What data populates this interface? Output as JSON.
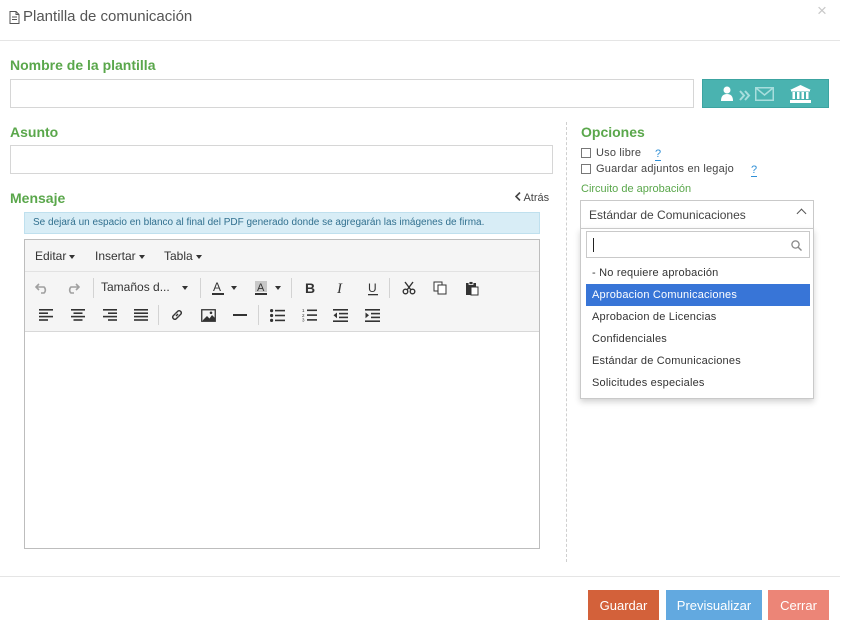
{
  "modal": {
    "title": "Plantilla de comunicación",
    "close_glyph": "×"
  },
  "nombre": {
    "label": "Nombre de la plantilla",
    "value": "",
    "icons": [
      "user-icon",
      "double-chevron-right-icon",
      "envelope-icon",
      "bank-icon"
    ]
  },
  "asunto": {
    "label": "Asunto",
    "value": ""
  },
  "mensaje": {
    "label": "Mensaje",
    "back_label": "Atrás",
    "info": "Se dejará un espacio en blanco al final del PDF generado donde se agregarán las imágenes de firma.",
    "menu": [
      "Editar",
      "Insertar",
      "Tabla"
    ],
    "font_sizes_label": "Tamaños d...",
    "toolbar_icons": [
      "undo-icon",
      "redo-icon",
      "font-color-icon",
      "background-color-icon",
      "bold-icon",
      "italic-icon",
      "underline-icon",
      "cut-icon",
      "copy-icon",
      "paste-icon",
      "align-left-icon",
      "align-center-icon",
      "align-right-icon",
      "align-justify-icon",
      "link-icon",
      "image-icon",
      "horizontal-rule-icon",
      "bullet-list-icon",
      "numbered-list-icon",
      "outdent-icon",
      "indent-icon"
    ],
    "content": ""
  },
  "opciones": {
    "label": "Opciones",
    "uso_libre": {
      "label": "Uso libre",
      "checked": false,
      "help": "?"
    },
    "guardar_adjuntos": {
      "label": "Guardar adjuntos en legajo",
      "checked": false,
      "help": "?"
    },
    "circuito_label": "Circuito de aprobación",
    "circuito_selected": "Estándar de Comunicaciones",
    "search_value": "",
    "options": [
      {
        "label": "- No requiere aprobación",
        "highlighted": false
      },
      {
        "label": "Aprobacion Comunicaciones",
        "highlighted": true
      },
      {
        "label": "Aprobacion de Licencias",
        "highlighted": false
      },
      {
        "label": "Confidenciales",
        "highlighted": false
      },
      {
        "label": "Estándar de Comunicaciones",
        "highlighted": false
      },
      {
        "label": "Solicitudes especiales",
        "highlighted": false
      }
    ]
  },
  "footer": {
    "guardar": "Guardar",
    "previsualizar": "Previsualizar",
    "cerrar": "Cerrar"
  },
  "colors": {
    "label_green": "#5aa74b",
    "teal": "#4ab3b0",
    "guardar_btn": "#d3613a",
    "previsualizar_btn": "#62a9e0",
    "cerrar_btn": "#ec8577",
    "selected_option": "#3875d7"
  }
}
